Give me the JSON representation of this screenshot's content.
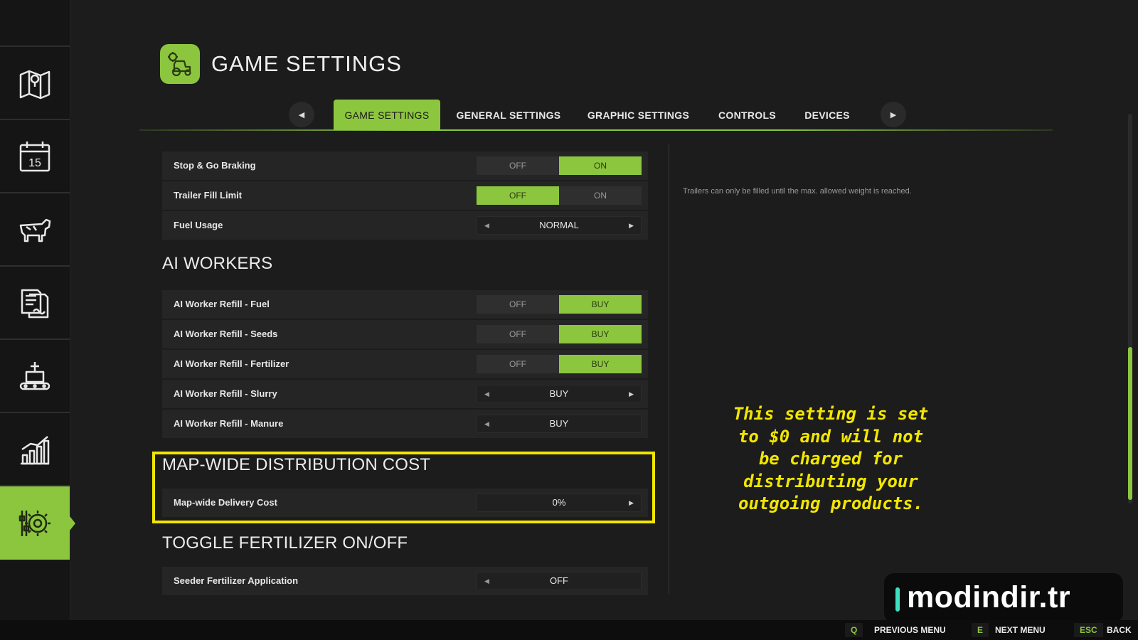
{
  "header": {
    "title": "GAME SETTINGS",
    "logo_icon": "tractor-gear-icon"
  },
  "sidebar": {
    "items": [
      {
        "icon": "map-icon",
        "active": false
      },
      {
        "icon": "calendar-icon",
        "active": false
      },
      {
        "icon": "cow-icon",
        "active": false
      },
      {
        "icon": "contracts-icon",
        "active": false
      },
      {
        "icon": "production-icon",
        "active": false
      },
      {
        "icon": "statistics-icon",
        "active": false
      },
      {
        "icon": "settings-sliders-icon",
        "active": true
      }
    ]
  },
  "tabs": [
    {
      "label": "GAME SETTINGS",
      "active": true
    },
    {
      "label": "GENERAL SETTINGS",
      "active": false
    },
    {
      "label": "GRAPHIC SETTINGS",
      "active": false
    },
    {
      "label": "CONTROLS",
      "active": false
    },
    {
      "label": "DEVICES",
      "active": false
    }
  ],
  "rows": {
    "stop_go": {
      "label": "Stop & Go Braking",
      "left": "OFF",
      "right": "ON",
      "selected": "right"
    },
    "trailer_fill": {
      "label": "Trailer Fill Limit",
      "left": "OFF",
      "right": "ON",
      "selected": "left"
    },
    "fuel_usage": {
      "label": "Fuel Usage",
      "value": "NORMAL"
    },
    "ai_fuel": {
      "label": "AI Worker Refill - Fuel",
      "left": "OFF",
      "right": "BUY",
      "selected": "right"
    },
    "ai_seeds": {
      "label": "AI Worker Refill - Seeds",
      "left": "OFF",
      "right": "BUY",
      "selected": "right"
    },
    "ai_fertilizer": {
      "label": "AI Worker Refill - Fertilizer",
      "left": "OFF",
      "right": "BUY",
      "selected": "right"
    },
    "ai_slurry": {
      "label": "AI Worker Refill - Slurry",
      "value": "BUY"
    },
    "ai_manure": {
      "label": "AI Worker Refill - Manure",
      "value": "BUY"
    },
    "delivery_cost": {
      "label": "Map-wide Delivery Cost",
      "value": "0%"
    },
    "seeder_fert": {
      "label": "Seeder Fertilizer Application",
      "value": "OFF"
    }
  },
  "sections": {
    "ai_workers": "AI WORKERS",
    "distribution": "MAP-WIDE DISTRIBUTION COST",
    "fertilizer": "TOGGLE FERTILIZER ON/OFF"
  },
  "description": "Trailers can only be filled until the max. allowed weight is reached.",
  "annotation": "This setting is set to $0 and will not be charged for distributing your outgoing products.",
  "watermark": "modindir.tr",
  "footer": {
    "prev_key": "Q",
    "prev_label": "PREVIOUS MENU",
    "next_key": "E",
    "next_label": "NEXT MENU",
    "back_key": "ESC",
    "back_label": "BACK"
  },
  "colors": {
    "accent": "#8cc63f",
    "highlight": "#f2e600",
    "background": "#1c1c1c"
  }
}
